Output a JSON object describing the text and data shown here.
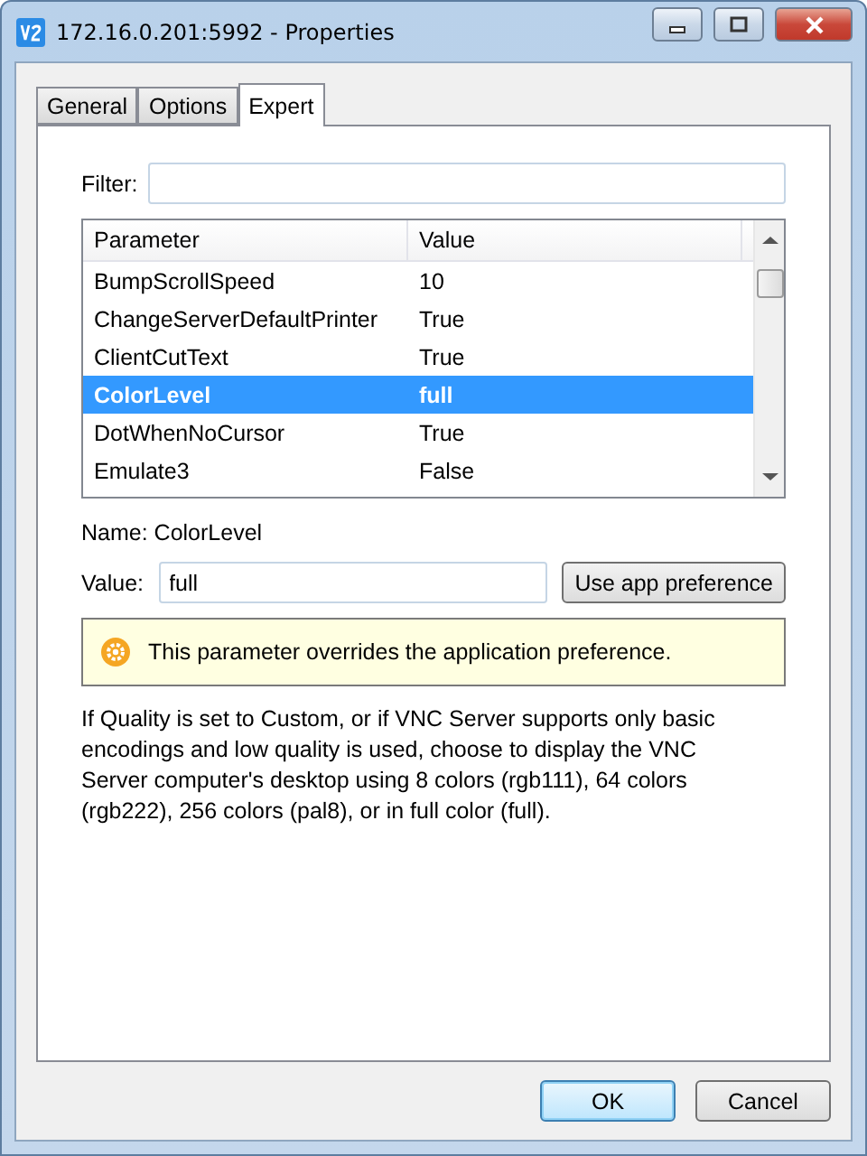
{
  "window": {
    "title": "172.16.0.201:5992 - Properties"
  },
  "tabs": [
    {
      "label": "General",
      "selected": false
    },
    {
      "label": "Options",
      "selected": false
    },
    {
      "label": "Expert",
      "selected": true
    }
  ],
  "filter": {
    "label": "Filter:"
  },
  "table": {
    "columns": [
      "Parameter",
      "Value"
    ],
    "rows": [
      {
        "parameter": "BumpScrollSpeed",
        "value": "10",
        "selected": false
      },
      {
        "parameter": "ChangeServerDefaultPrinter",
        "value": "True",
        "selected": false
      },
      {
        "parameter": "ClientCutText",
        "value": "True",
        "selected": false
      },
      {
        "parameter": "ColorLevel",
        "value": "full",
        "selected": true
      },
      {
        "parameter": "DotWhenNoCursor",
        "value": "True",
        "selected": false
      },
      {
        "parameter": "Emulate3",
        "value": "False",
        "selected": false
      }
    ]
  },
  "name_line": "Name: ColorLevel",
  "value_field": {
    "label": "Value:",
    "value": "full"
  },
  "use_app_button": "Use app preference",
  "notice": "This parameter overrides the application preference.",
  "description": "If Quality is set to Custom, or if VNC Server supports only basic encodings and low quality is used, choose to display the VNC Server computer's desktop using 8 colors (rgb111), 64 colors (rgb222), 256 colors (pal8), or in full color (full).",
  "buttons": [
    {
      "label": "OK",
      "default": true
    },
    {
      "label": "Cancel",
      "default": false
    }
  ]
}
